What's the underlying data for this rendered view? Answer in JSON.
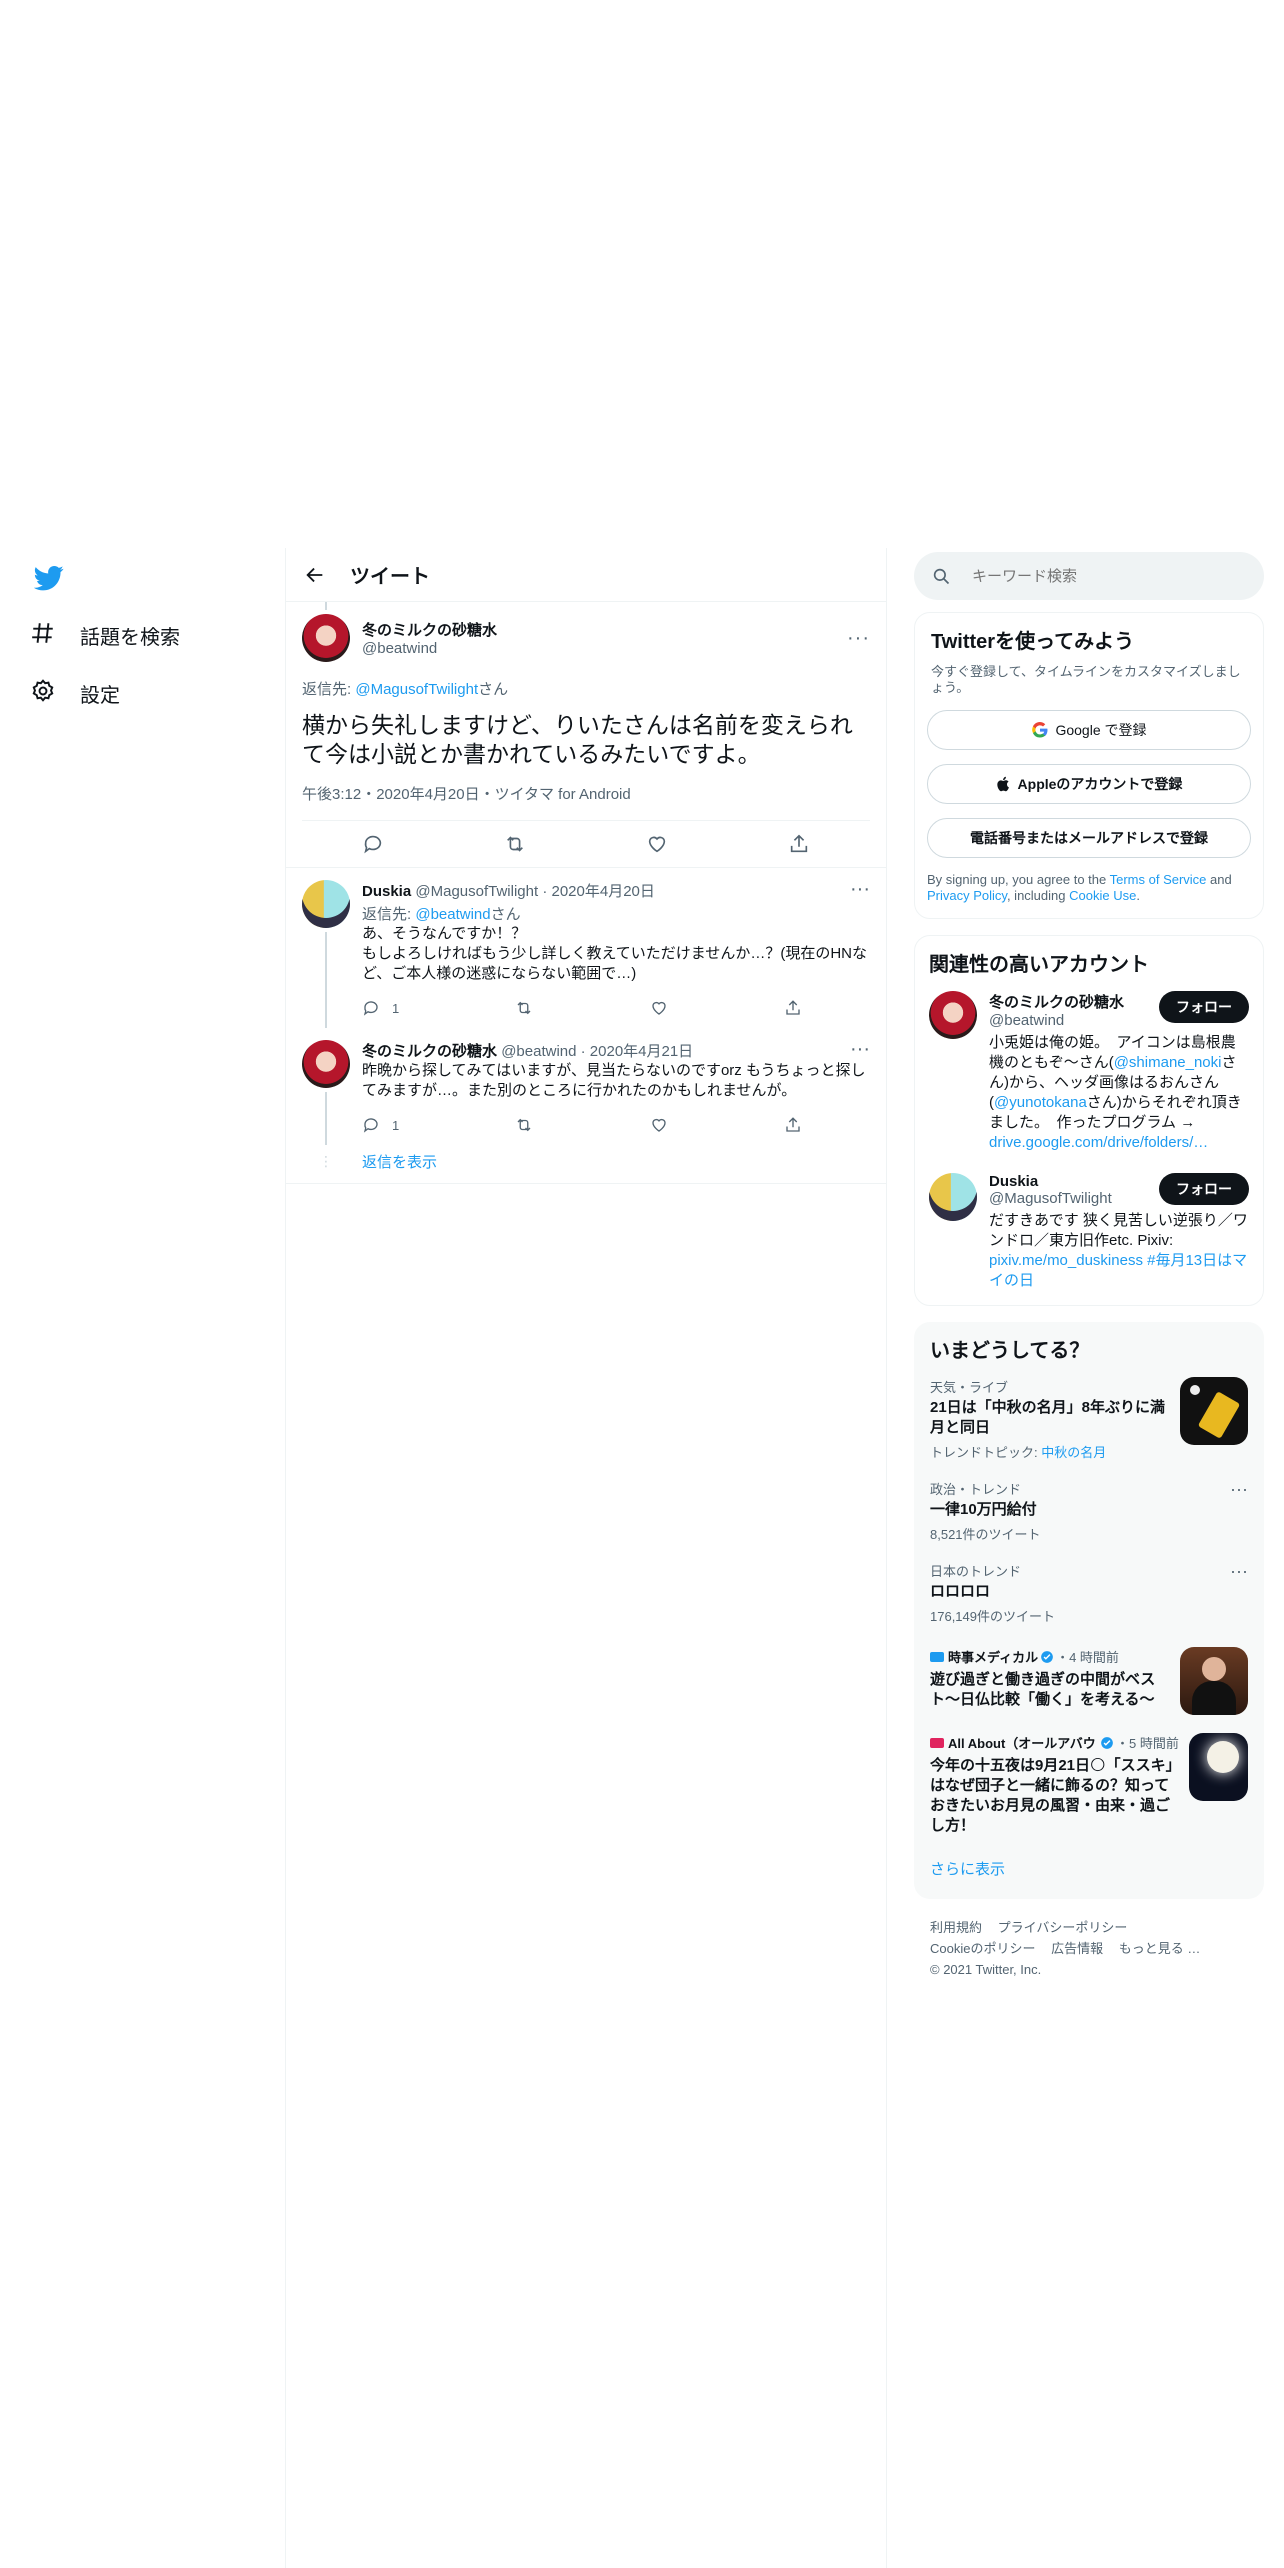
{
  "nav": {
    "explore_label": "話題を検索",
    "settings_label": "設定"
  },
  "header": {
    "title": "ツイート"
  },
  "main_tweet": {
    "name": "冬のミルクの砂糖水",
    "handle": "@beatwind",
    "reply_prefix": "返信先: ",
    "reply_to": "@MagusofTwilight",
    "reply_suffix": "さん",
    "text": "横から失礼しますけど、りいたさんは名前を変えられて今は小説とか書かれているみたいですよ。",
    "meta": "午後3:12・2020年4月20日・ツイタマ for Android"
  },
  "replies": [
    {
      "name": "Duskia",
      "handle_date": "@MagusofTwilight · 2020年4月20日",
      "reply_prefix": "返信先: ",
      "reply_to": "@beatwind",
      "reply_suffix": "さん",
      "text": "あ、そうなんですか！？\nもしよろしければもう少し詳しく教えていただけませんか…？(現在のHNなど、ご本人様の迷惑にならない範囲で…)",
      "reply_count": "1"
    },
    {
      "name": "冬のミルクの砂糖水",
      "handle_date": "@beatwind · 2020年4月21日",
      "text": "昨晩から探してみてはいますが、見当たらないのですorz もうちょっと探してみますが…。また別のところに行かれたのかもしれませんが。",
      "reply_count": "1"
    }
  ],
  "show_replies": "返信を表示",
  "search": {
    "placeholder": "キーワード検索"
  },
  "signup": {
    "title": "Twitterを使ってみよう",
    "subtitle": "今すぐ登録して、タイムラインをカスタマイズしましょう。",
    "google": "Google で登録",
    "apple": "Appleのアカウントで登録",
    "phone": "電話番号またはメールアドレスで登録",
    "legal_1": "By signing up, you agree to the ",
    "tos": "Terms of Service",
    "legal_2": " and ",
    "privacy": "Privacy Policy",
    "legal_3": ", including ",
    "cookie": "Cookie Use",
    "legal_4": "."
  },
  "related": {
    "title": "関連性の高いアカウント",
    "follow_label": "フォロー",
    "accounts": [
      {
        "name": "冬のミルクの砂糖水",
        "handle": "@beatwind",
        "bio_1": "小兎姫は俺の姫。　アイコンは島根農機のともぞ～さん(",
        "bio_link_1": "@shimane_noki",
        "bio_2": "さん)から、ヘッダ画像はるおんさん(",
        "bio_link_2": "@yunotokana",
        "bio_3": "さん)からそれぞれ頂きました。　作ったプログラム →",
        "bio_link_3": "drive.google.com/drive/folders/…"
      },
      {
        "name": "Duskia",
        "handle": "@MagusofTwilight",
        "bio_1": "だすきあです 狭く見苦しい逆張り／ワンドロ／東方旧作etc. Pixiv:",
        "bio_link_1": "pixiv.me/mo_duskiness",
        "bio_link_2": "#毎月13日はマイの日"
      }
    ]
  },
  "trends": {
    "title": "いまどうしてる？",
    "items": [
      {
        "meta": "天気・ライブ",
        "title": "21日は「中秋の名月」8年ぶりに満月と同日",
        "sub_prefix": "トレンドトピック: ",
        "sub_link": "中秋の名月"
      },
      {
        "meta": "政治・トレンド",
        "title": "一律10万円給付",
        "count": "8,521件のツイート"
      },
      {
        "meta": "日本のトレンド",
        "title": "ロロロロ",
        "count": "176,149件のツイート"
      },
      {
        "source": "時事メディカル",
        "time": "・4 時間前",
        "title": "遊び過ぎと働き過ぎの中間がベスト～日仏比較「働く」を考える～"
      },
      {
        "source": "All About（オールアバウト）",
        "time": "・5 時間前",
        "title": "今年の十五夜は9月21日🌕「ススキ」はなぜ団子と一緒に飾るの？知っておきたいお月見の風習・由来・過ごし方！"
      }
    ],
    "show_more": "さらに表示"
  },
  "footer": {
    "links": [
      "利用規約",
      "プライバシーポリシー",
      "Cookieのポリシー",
      "広告情報",
      "もっと見る …"
    ],
    "copyright": "© 2021 Twitter, Inc."
  },
  "colors": {
    "accent": "#1d9bf0",
    "text": "#0f1419",
    "muted": "#536471",
    "border": "#eff3f4"
  }
}
